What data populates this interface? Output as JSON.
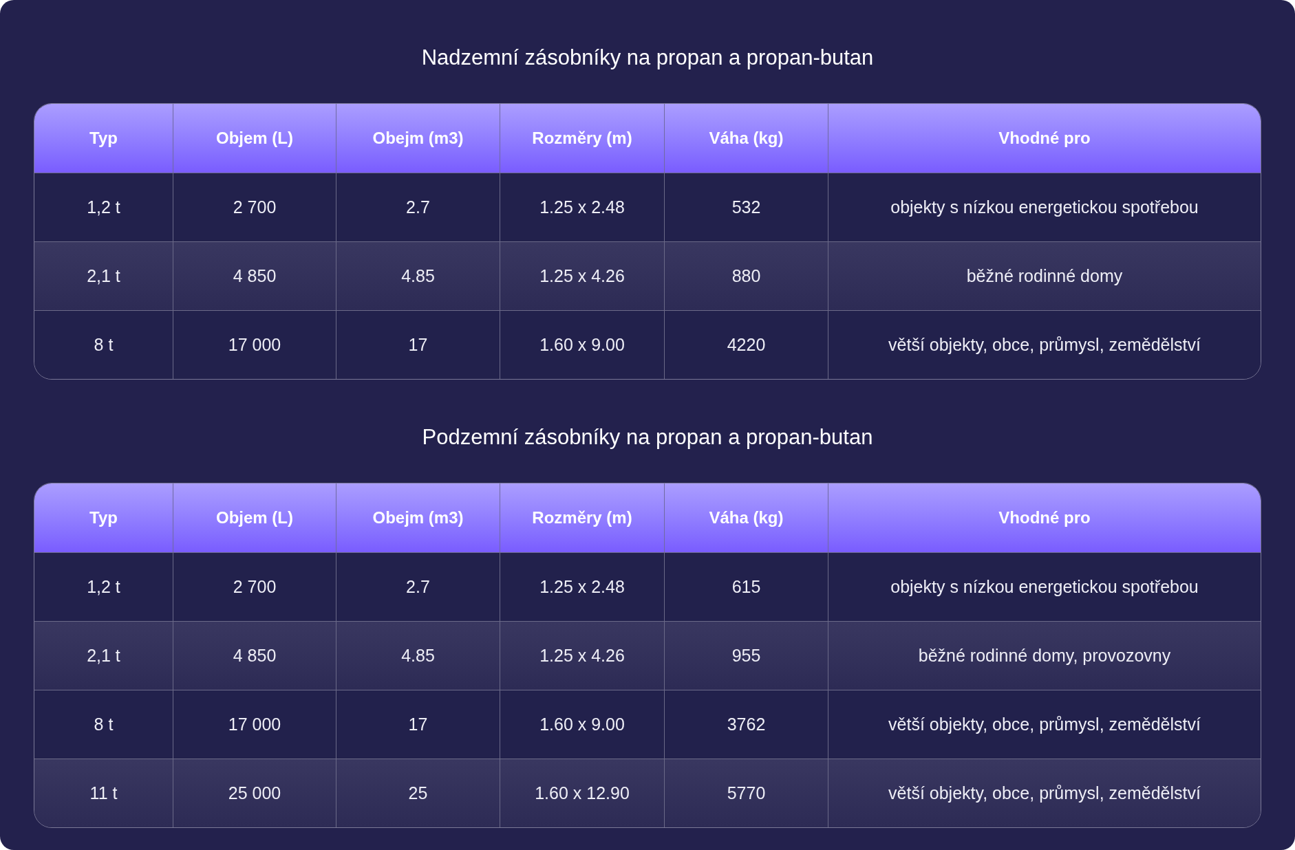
{
  "tables": [
    {
      "title": "Nadzemní zásobníky na propan a propan-butan",
      "columns": [
        "Typ",
        "Objem (L)",
        "Obejm (m3)",
        "Rozměry (m)",
        "Váha (kg)",
        "Vhodné pro"
      ],
      "rows": [
        [
          "1,2 t",
          "2 700",
          "2.7",
          "1.25 x 2.48",
          "532",
          "objekty s nízkou energetickou spotřebou"
        ],
        [
          "2,1 t",
          "4 850",
          "4.85",
          "1.25 x 4.26",
          "880",
          "běžné rodinné domy"
        ],
        [
          "8 t",
          "17 000",
          "17",
          "1.60 x 9.00",
          "4220",
          "větší objekty, obce, průmysl, zemědělství"
        ]
      ]
    },
    {
      "title": "Podzemní zásobníky na propan a propan-butan",
      "columns": [
        "Typ",
        "Objem (L)",
        "Obejm (m3)",
        "Rozměry (m)",
        "Váha (kg)",
        "Vhodné pro"
      ],
      "rows": [
        [
          "1,2 t",
          "2 700",
          "2.7",
          "1.25 x 2.48",
          "615",
          "objekty s nízkou energetickou spotřebou"
        ],
        [
          "2,1 t",
          "4 850",
          "4.85",
          "1.25 x 4.26",
          "955",
          "běžné rodinné domy, provozovny"
        ],
        [
          "8 t",
          "17 000",
          "17",
          "1.60 x 9.00",
          "3762",
          "větší objekty, obce, průmysl, zemědělství"
        ],
        [
          "11 t",
          "25 000",
          "25",
          "1.60 x 12.90",
          "5770",
          "větší objekty, obce, průmysl, zemědělství"
        ]
      ]
    }
  ]
}
